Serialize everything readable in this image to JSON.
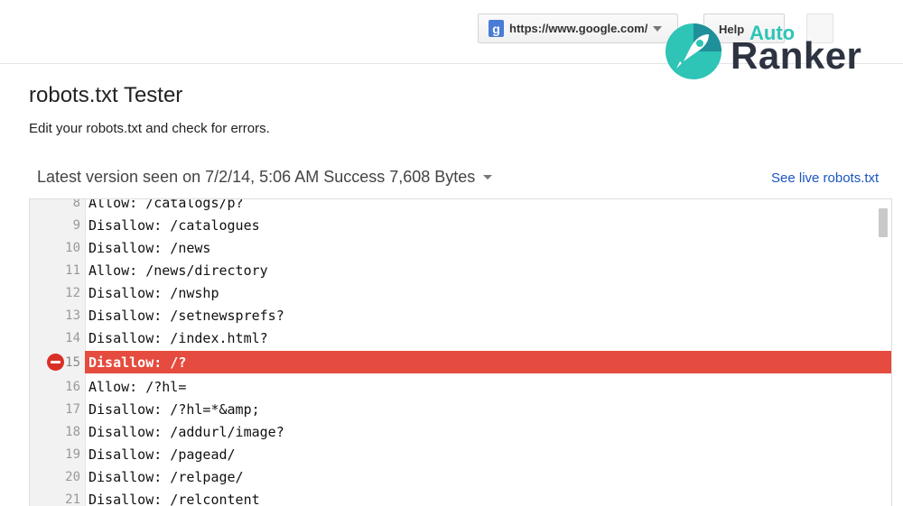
{
  "toolbar": {
    "property_badge": "g",
    "property_url": "https://www.google.com/",
    "help_label": "Help"
  },
  "watermark": {
    "word_top": "Auto",
    "word_main": "Ranker"
  },
  "page": {
    "title": "robots.txt Tester",
    "subtitle": "Edit your robots.txt and check for errors."
  },
  "version_info": {
    "label": "Latest version seen on 7/2/14, 5:06 AM Success 7,608 Bytes",
    "live_link": "See live robots.txt"
  },
  "editor": {
    "lines": [
      {
        "number": "8",
        "text": "Allow: /catalogs/p?"
      },
      {
        "number": "9",
        "text": "Disallow: /catalogues"
      },
      {
        "number": "10",
        "text": "Disallow: /news"
      },
      {
        "number": "11",
        "text": "Allow: /news/directory"
      },
      {
        "number": "12",
        "text": "Disallow: /nwshp"
      },
      {
        "number": "13",
        "text": "Disallow: /setnewsprefs?"
      },
      {
        "number": "14",
        "text": "Disallow: /index.html?"
      },
      {
        "number": "15",
        "text": "Disallow: /?"
      },
      {
        "number": "16",
        "text": "Allow: /?hl="
      },
      {
        "number": "17",
        "text": "Disallow: /?hl=*&amp;"
      },
      {
        "number": "18",
        "text": "Disallow: /addurl/image?"
      },
      {
        "number": "19",
        "text": "Disallow: /pagead/"
      },
      {
        "number": "20",
        "text": "Disallow: /relpage/"
      },
      {
        "number": "21",
        "text": "Disallow: /relcontent"
      }
    ],
    "error_line": "15",
    "error_color": "#e54b3e"
  },
  "colors": {
    "link": "#1a55c4",
    "brand_teal": "#2ec4b6"
  }
}
